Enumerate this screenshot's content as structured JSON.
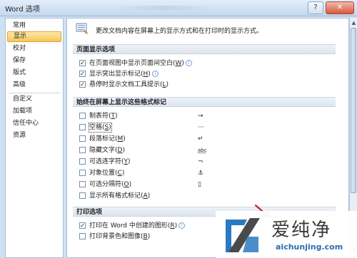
{
  "window": {
    "title": "Word 选项"
  },
  "sidebar": {
    "items": [
      {
        "label": "常用"
      },
      {
        "label": "显示"
      },
      {
        "label": "校对"
      },
      {
        "label": "保存"
      },
      {
        "label": "版式"
      },
      {
        "label": "高级"
      },
      {
        "label": "自定义"
      },
      {
        "label": "加载项"
      },
      {
        "label": "信任中心"
      },
      {
        "label": "资源"
      }
    ],
    "selected_index": 1
  },
  "header": {
    "description": "更改文档内容在屏幕上的显示方式和在打印时的显示方式。"
  },
  "sections": {
    "page_display": {
      "title": "页面显示选项",
      "options": [
        {
          "label": "在页面视图中显示页面间空白(",
          "key": "W",
          "checked": true,
          "info": true
        },
        {
          "label": "显示突出显示标记(",
          "key": "H",
          "checked": true,
          "info": true
        },
        {
          "label": "悬停时显示文档工具提示(",
          "key": "L",
          "checked": true,
          "info": false
        }
      ]
    },
    "formatting_marks": {
      "title": "始终在屏幕上显示这些格式标记",
      "options": [
        {
          "label": "制表符(",
          "key": "T",
          "checked": false,
          "mark": "→"
        },
        {
          "label": "空格(",
          "key": "S",
          "checked": false,
          "mark": "···"
        },
        {
          "label": "段落标记(",
          "key": "M",
          "checked": false,
          "mark": "↵"
        },
        {
          "label": "隐藏文字(",
          "key": "D",
          "checked": false,
          "mark": "abc"
        },
        {
          "label": "可选连字符(",
          "key": "Y",
          "checked": false,
          "mark": "¬"
        },
        {
          "label": "对象位置(",
          "key": "C",
          "checked": false,
          "mark": "⚓"
        },
        {
          "label": "可选分隔符(",
          "key": "O",
          "checked": false,
          "mark": "▯"
        },
        {
          "label": "显示所有格式标记(",
          "key": "A",
          "checked": false,
          "mark": ""
        }
      ]
    },
    "print": {
      "title": "打印选项",
      "options": [
        {
          "label": "打印在 Word 中创建的图形(",
          "key": "R",
          "checked": true,
          "info": true
        },
        {
          "label": "打印背景色和图像(",
          "key": "B",
          "checked": false,
          "info": false
        }
      ]
    }
  },
  "watermark": {
    "title": "爱纯净",
    "url": "aichunjing.com"
  },
  "colors": {
    "selected_item": "#f6c65a",
    "section_bar": "#dde5ef",
    "window_frame": "#cfe0f3",
    "watermark_red": "#c8202f"
  }
}
